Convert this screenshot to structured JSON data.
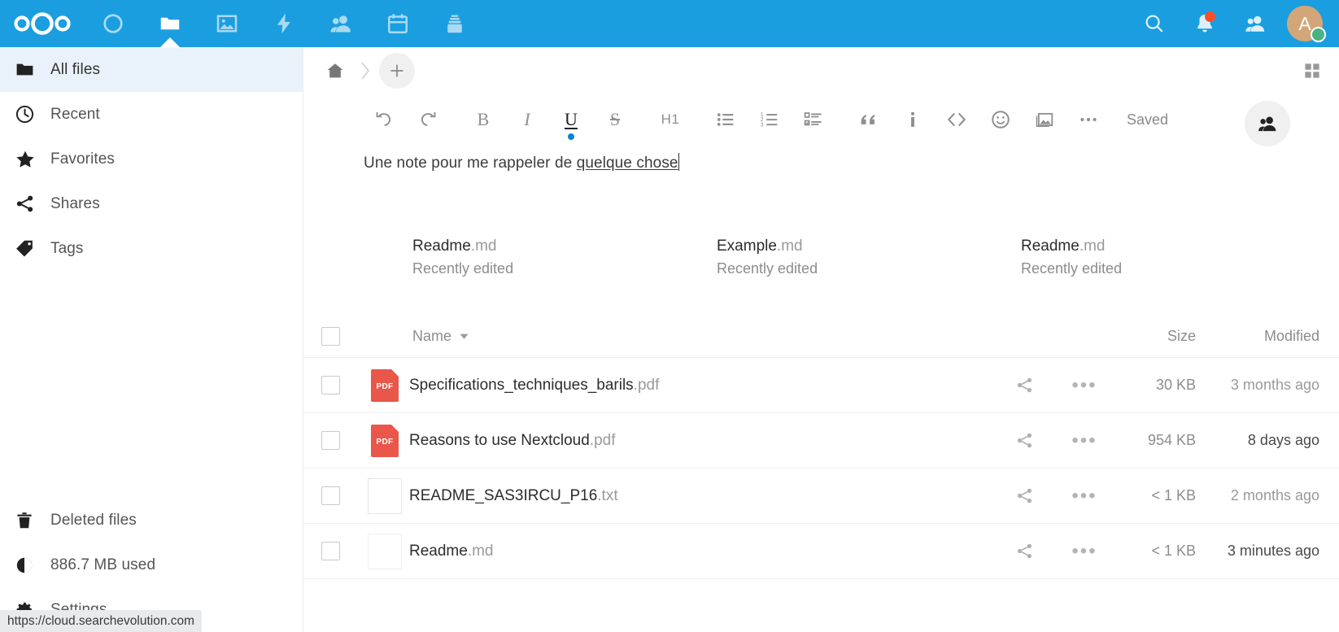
{
  "header": {
    "logo_name": "nextcloud-logo",
    "apps": [
      {
        "name": "dashboard",
        "icon": "circle-icon",
        "active": false
      },
      {
        "name": "files",
        "icon": "folder-icon",
        "active": true
      },
      {
        "name": "photos",
        "icon": "image-icon",
        "active": false
      },
      {
        "name": "activity",
        "icon": "lightning-icon",
        "active": false
      },
      {
        "name": "contacts",
        "icon": "contacts-icon",
        "active": false
      },
      {
        "name": "calendar",
        "icon": "calendar-icon",
        "active": false
      },
      {
        "name": "deck",
        "icon": "deck-icon",
        "active": false
      }
    ],
    "search_icon": "search-icon",
    "notifications_icon": "bell-icon",
    "contacts_menu_icon": "contacts-icon",
    "avatar_initial": "A",
    "avatar_color": "#d2a679",
    "status_color": "#49b382",
    "brand_color": "#1a9ee0"
  },
  "sidebar": {
    "items": [
      {
        "label": "All files",
        "icon": "folder-icon",
        "active": true
      },
      {
        "label": "Recent",
        "icon": "clock-icon",
        "active": false
      },
      {
        "label": "Favorites",
        "icon": "star-icon",
        "active": false
      },
      {
        "label": "Shares",
        "icon": "share-icon",
        "active": false
      },
      {
        "label": "Tags",
        "icon": "tag-icon",
        "active": false
      }
    ],
    "bottom_items": [
      {
        "label": "Deleted files",
        "icon": "trash-icon"
      },
      {
        "label": "886.7 MB used",
        "icon": "pie-chart-icon"
      },
      {
        "label": "Settings",
        "icon": "gear-icon"
      }
    ]
  },
  "statusbar": {
    "url": "https://cloud.searchevolution.com"
  },
  "breadcrumb": {
    "home_icon": "home-icon",
    "separator_icon": "chevron-right-icon",
    "new_label": "+",
    "grid_view_icon": "grid-view-icon"
  },
  "editor": {
    "toolbar": [
      {
        "name": "undo",
        "icon": "undo-icon",
        "label": "",
        "active": false
      },
      {
        "name": "redo",
        "icon": "redo-icon",
        "label": "",
        "active": false
      },
      {
        "name": "bold",
        "icon": "bold-icon",
        "label": "B",
        "active": false
      },
      {
        "name": "italic",
        "icon": "italic-icon",
        "label": "I",
        "active": false
      },
      {
        "name": "underline",
        "icon": "underline-icon",
        "label": "U",
        "active": true
      },
      {
        "name": "strikethrough",
        "icon": "strikethrough-icon",
        "label": "S",
        "active": false
      },
      {
        "name": "heading",
        "icon": "heading-icon",
        "label": "H1",
        "active": false
      },
      {
        "name": "bullet-list",
        "icon": "bullet-list-icon",
        "label": "",
        "active": false
      },
      {
        "name": "ordered-list",
        "icon": "ordered-list-icon",
        "label": "",
        "active": false
      },
      {
        "name": "task-list",
        "icon": "task-list-icon",
        "label": "",
        "active": false
      },
      {
        "name": "blockquote",
        "icon": "quote-icon",
        "label": "",
        "active": false
      },
      {
        "name": "info",
        "icon": "info-icon",
        "label": "",
        "active": false
      },
      {
        "name": "code-block",
        "icon": "code-icon",
        "label": "",
        "active": false
      },
      {
        "name": "emoji",
        "icon": "emoji-icon",
        "label": "",
        "active": false
      },
      {
        "name": "insert-image",
        "icon": "image-icon",
        "label": "",
        "active": false
      },
      {
        "name": "more-actions",
        "icon": "ellipsis-icon",
        "label": "",
        "active": false
      }
    ],
    "save_status": "Saved",
    "collaborators_icon": "people-icon",
    "content_plain": "Une note pour me rappeler de ",
    "content_underlined": "quelque chose",
    "active_marker_color": "#0a84d4"
  },
  "recent_cards": [
    {
      "name": "Readme",
      "ext": ".md",
      "subtitle": "Recently edited",
      "thumb": "blank-document-thumb"
    },
    {
      "name": "Example",
      "ext": ".md",
      "subtitle": "Recently edited",
      "thumb": "text-document-thumb"
    },
    {
      "name": "Readme",
      "ext": ".md",
      "subtitle": "Recently edited",
      "thumb": "sparse-document-thumb"
    }
  ],
  "file_table": {
    "columns": {
      "name": "Name",
      "size": "Size",
      "modified": "Modified"
    },
    "sort_icon": "sort-descending-icon",
    "select_all_checkbox": false,
    "rows": [
      {
        "name": "Specifications_techniques_barils",
        "ext": ".pdf",
        "icon": "pdf-icon",
        "size": "30 KB",
        "modified": "3 months ago",
        "recent": false,
        "share_icon": "share-icon",
        "more_icon": "ellipsis-icon"
      },
      {
        "name": "Reasons to use Nextcloud",
        "ext": ".pdf",
        "icon": "pdf-icon",
        "size": "954 KB",
        "modified": "8 days ago",
        "recent": true,
        "share_icon": "share-icon",
        "more_icon": "ellipsis-icon"
      },
      {
        "name": "README_SAS3IRCU_P16",
        "ext": ".txt",
        "icon": "text-file-icon",
        "size": "< 1 KB",
        "modified": "2 months ago",
        "recent": false,
        "share_icon": "share-icon",
        "more_icon": "ellipsis-icon"
      },
      {
        "name": "Readme",
        "ext": ".md",
        "icon": "blank-file-icon",
        "size": "< 1 KB",
        "modified": "3 minutes ago",
        "recent": true,
        "share_icon": "share-icon",
        "more_icon": "ellipsis-icon"
      }
    ]
  }
}
